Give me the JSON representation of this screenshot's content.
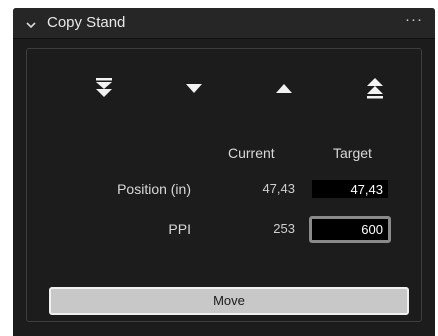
{
  "header": {
    "title": "Copy Stand",
    "more_label": "···"
  },
  "columns": {
    "current": "Current",
    "target": "Target"
  },
  "rows": [
    {
      "label": "Position (in)",
      "current": "47,43",
      "target": "47,43"
    },
    {
      "label": "PPI",
      "current": "253",
      "target": "600"
    }
  ],
  "buttons": {
    "move": "Move"
  },
  "icons": {
    "collapse": "chevron-down-icon",
    "fast_down": "double-down-arrow-icon",
    "down": "down-arrow-icon",
    "up": "up-arrow-icon",
    "fast_up": "double-up-arrow-icon",
    "more": "more-options-icon"
  },
  "colors": {
    "panel_background": "#1c1c1c",
    "header_background": "#262626",
    "button_background": "#c8c8c8"
  }
}
